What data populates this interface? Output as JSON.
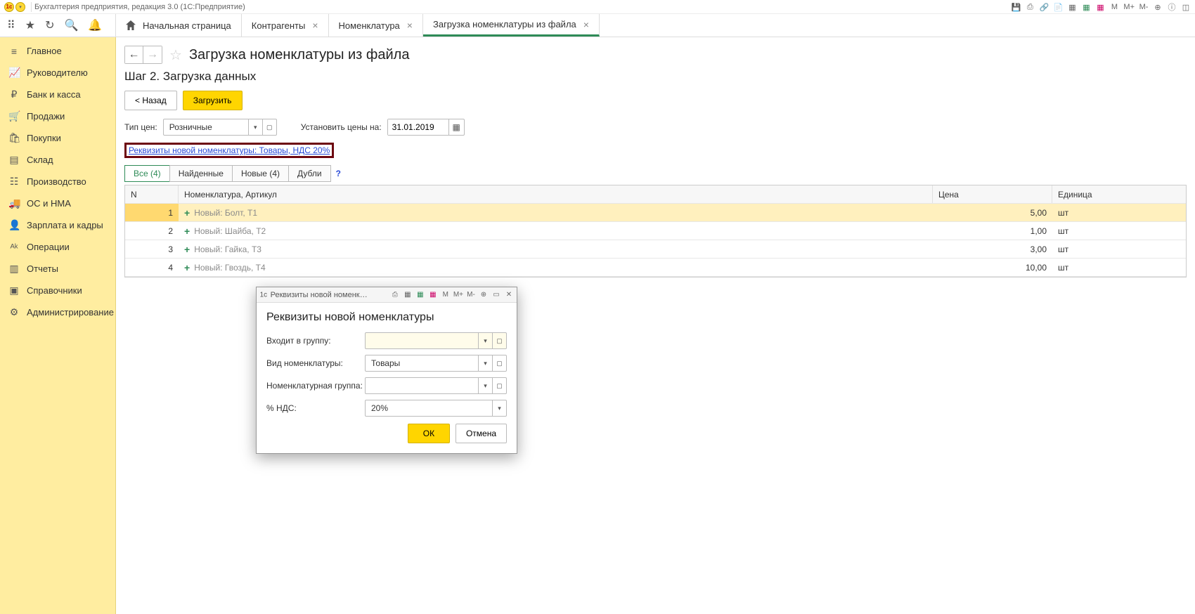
{
  "titlebar": {
    "app_title": "Бухгалтерия предприятия, редакция 3.0  (1С:Предприятие)",
    "icon_badge": "1c"
  },
  "top_icons": {
    "m": "M",
    "mplus": "M+",
    "mminus": "M-"
  },
  "toolbar": {
    "apps": "⦙⦙⦙",
    "star": "★",
    "history": "↺",
    "search": "⌕",
    "bell": "🔔"
  },
  "tabs": {
    "home": "Начальная страница",
    "t1": "Контрагенты",
    "t2": "Номенклатура",
    "t3": "Загрузка номенклатуры из файла"
  },
  "sidebar": {
    "items": [
      {
        "icon": "≡",
        "label": "Главное"
      },
      {
        "icon": "📈",
        "label": "Руководителю"
      },
      {
        "icon": "₽",
        "label": "Банк и касса"
      },
      {
        "icon": "🛒",
        "label": "Продажи"
      },
      {
        "icon": "🛍",
        "label": "Покупки"
      },
      {
        "icon": "▤",
        "label": "Склад"
      },
      {
        "icon": "☷",
        "label": "Производство"
      },
      {
        "icon": "🚚",
        "label": "ОС и НМА"
      },
      {
        "icon": "👤",
        "label": "Зарплата и кадры"
      },
      {
        "icon": "ᴬᵏ",
        "label": "Операции"
      },
      {
        "icon": "▥",
        "label": "Отчеты"
      },
      {
        "icon": "▣",
        "label": "Справочники"
      },
      {
        "icon": "⚙",
        "label": "Администрирование"
      }
    ]
  },
  "page": {
    "title": "Загрузка номенклатуры из файла",
    "step": "Шаг 2. Загрузка данных",
    "btn_back": "< Назад",
    "btn_load": "Загрузить",
    "pricetype_label": "Тип цен:",
    "pricetype_value": "Розничные",
    "setprice_label": "Установить цены на:",
    "setprice_date": "31.01.2019",
    "highlight_link": "Реквизиты новой номенклатуры: Товары, НДС 20%",
    "filter_tabs": {
      "all": "Все (4)",
      "found": "Найденные",
      "new": "Новые (4)",
      "dups": "Дубли"
    }
  },
  "table": {
    "headers": {
      "n": "N",
      "nomen": "Номенклатура, Артикул",
      "price": "Цена",
      "unit": "Единица"
    },
    "rows": [
      {
        "n": "1",
        "name": "Новый: Болт, Т1",
        "price": "5,00",
        "unit": "шт"
      },
      {
        "n": "2",
        "name": "Новый: Шайба, Т2",
        "price": "1,00",
        "unit": "шт"
      },
      {
        "n": "3",
        "name": "Новый: Гайка, Т3",
        "price": "3,00",
        "unit": "шт"
      },
      {
        "n": "4",
        "name": "Новый: Гвоздь, Т4",
        "price": "10,00",
        "unit": "шт"
      }
    ]
  },
  "modal": {
    "title_short": "Реквизиты новой номенклат...",
    "m": "M",
    "mplus": "M+",
    "mminus": "M-",
    "heading": "Реквизиты новой номенклатуры",
    "f_group": "Входит в группу:",
    "f_group_value": "",
    "f_type": "Вид номенклатуры:",
    "f_type_value": "Товары",
    "f_ngroup": "Номенклатурная группа:",
    "f_ngroup_value": "",
    "f_vat": "% НДС:",
    "f_vat_value": "20%",
    "ok": "ОК",
    "cancel": "Отмена"
  }
}
